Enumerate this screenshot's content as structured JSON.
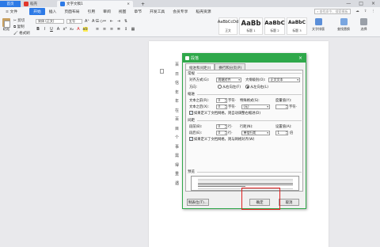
{
  "titlebar": {
    "tabs": [
      {
        "label": "首页"
      },
      {
        "label": "稻壳"
      },
      {
        "label": "文字文稿1"
      }
    ],
    "new_tab": "+",
    "window_controls": [
      "—",
      "□",
      "×"
    ]
  },
  "menubar": {
    "file": "≡ 文件",
    "items": [
      "开始",
      "插入",
      "页面布局",
      "引用",
      "审阅",
      "视图",
      "章节",
      "开发工具",
      "会员专享",
      "稻壳资源"
    ],
    "active": "开始",
    "search_placeholder": "查找命令、搜索模板"
  },
  "ribbon": {
    "paste": "粘贴",
    "cut": "剪切",
    "copy": "复制",
    "format_painter": "格式刷",
    "font_name": "宋体 (正文)",
    "font_size": "五号",
    "styles": [
      {
        "sample": "AaBbCcDd",
        "label": "正文"
      },
      {
        "sample": "AaBb",
        "label": "标题 1"
      },
      {
        "sample": "AaBbC",
        "label": "标题 2"
      },
      {
        "sample": "AaBbC",
        "label": "标题 3"
      }
    ],
    "text_layout": "文字排版",
    "find_replace": "查找替换",
    "select": "选择"
  },
  "document": {
    "lines": [
      "百",
      "日",
      "信",
      "年",
      "年",
      "在",
      "百",
      "目",
      "个",
      "事",
      "需",
      "得",
      "重",
      "遇"
    ]
  },
  "dialog": {
    "title": "段落",
    "tabs": [
      "缩进和间距(I)",
      "换行和分页(P)"
    ],
    "general": {
      "title": "常规",
      "alignment_label": "对齐方式(G):",
      "alignment_value": "两端对齐",
      "outline_label": "大纲级别(O):",
      "outline_value": "正文文本",
      "direction_label": "方向:",
      "rtl": "从右向左(F)",
      "ltr": "从左向右(L)"
    },
    "indent": {
      "title": "缩进",
      "before_label": "文本之前(R):",
      "before_value": "0",
      "before_unit": "字符·",
      "special_label": "特殊格式(S):",
      "special_value": "(无)",
      "measure_label": "度量值(Y):",
      "measure_unit": "字符·",
      "after_label": "文本之后(X):",
      "after_value": "0",
      "after_unit": "字符·",
      "grid_check": "如果定义了文档网格，则自动调整右缩进(D)"
    },
    "spacing": {
      "title": "间距",
      "before_label": "段前(B):",
      "before_value": "0",
      "before_unit": "行·",
      "line_label": "行距(N):",
      "line_value": "单倍行距",
      "setting_label": "设置值(A):",
      "setting_value": "1",
      "setting_unit": "倍",
      "after_label": "段后(E):",
      "after_value": "0",
      "after_unit": "行·",
      "grid_check": "如果定义了文档网格，则与网格对齐(W)"
    },
    "preview_title": "预览",
    "tabs_button": "制表位(T)...",
    "ok": "确定",
    "cancel": "取消"
  }
}
